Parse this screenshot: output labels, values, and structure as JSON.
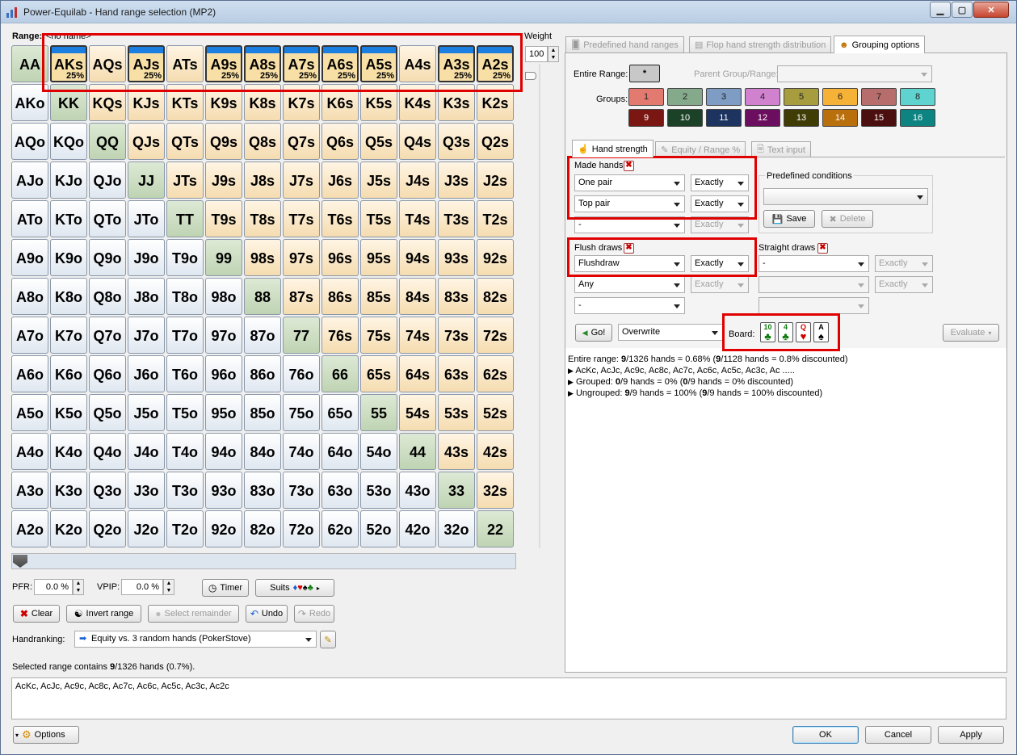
{
  "window": {
    "title": "Power-Equilab - Hand range selection (MP2)"
  },
  "range": {
    "label": "Range:",
    "name": "<no name>",
    "weight_label": "Weight",
    "weight_value": "100"
  },
  "grid": {
    "rows": [
      [
        "AA",
        "AKs",
        "AQs",
        "AJs",
        "ATs",
        "A9s",
        "A8s",
        "A7s",
        "A6s",
        "A5s",
        "A4s",
        "A3s",
        "A2s"
      ],
      [
        "AKo",
        "KK",
        "KQs",
        "KJs",
        "KTs",
        "K9s",
        "K8s",
        "K7s",
        "K6s",
        "K5s",
        "K4s",
        "K3s",
        "K2s"
      ],
      [
        "AQo",
        "KQo",
        "QQ",
        "QJs",
        "QTs",
        "Q9s",
        "Q8s",
        "Q7s",
        "Q6s",
        "Q5s",
        "Q4s",
        "Q3s",
        "Q2s"
      ],
      [
        "AJo",
        "KJo",
        "QJo",
        "JJ",
        "JTs",
        "J9s",
        "J8s",
        "J7s",
        "J6s",
        "J5s",
        "J4s",
        "J3s",
        "J2s"
      ],
      [
        "ATo",
        "KTo",
        "QTo",
        "JTo",
        "TT",
        "T9s",
        "T8s",
        "T7s",
        "T6s",
        "T5s",
        "T4s",
        "T3s",
        "T2s"
      ],
      [
        "A9o",
        "K9o",
        "Q9o",
        "J9o",
        "T9o",
        "99",
        "98s",
        "97s",
        "96s",
        "95s",
        "94s",
        "93s",
        "92s"
      ],
      [
        "A8o",
        "K8o",
        "Q8o",
        "J8o",
        "T8o",
        "98o",
        "88",
        "87s",
        "86s",
        "85s",
        "84s",
        "83s",
        "82s"
      ],
      [
        "A7o",
        "K7o",
        "Q7o",
        "J7o",
        "T7o",
        "97o",
        "87o",
        "77",
        "76s",
        "75s",
        "74s",
        "73s",
        "72s"
      ],
      [
        "A6o",
        "K6o",
        "Q6o",
        "J6o",
        "T6o",
        "96o",
        "86o",
        "76o",
        "66",
        "65s",
        "64s",
        "63s",
        "62s"
      ],
      [
        "A5o",
        "K5o",
        "Q5o",
        "J5o",
        "T5o",
        "95o",
        "85o",
        "75o",
        "65o",
        "55",
        "54s",
        "53s",
        "52s"
      ],
      [
        "A4o",
        "K4o",
        "Q4o",
        "J4o",
        "T4o",
        "94o",
        "84o",
        "74o",
        "64o",
        "54o",
        "44",
        "43s",
        "42s"
      ],
      [
        "A3o",
        "K3o",
        "Q3o",
        "J3o",
        "T3o",
        "93o",
        "83o",
        "73o",
        "63o",
        "53o",
        "43o",
        "33",
        "32s"
      ],
      [
        "A2o",
        "K2o",
        "Q2o",
        "J2o",
        "T2o",
        "92o",
        "82o",
        "72o",
        "62o",
        "52o",
        "42o",
        "32o",
        "22"
      ]
    ],
    "selected": {
      "AKs": "25%",
      "AJs": "25%",
      "A9s": "25%",
      "A8s": "25%",
      "A7s": "25%",
      "A6s": "25%",
      "A5s": "25%",
      "A3s": "25%",
      "A2s": "25%"
    }
  },
  "controls": {
    "pfr_label": "PFR:",
    "pfr_value": "0.0 %",
    "vpip_label": "VPIP:",
    "vpip_value": "0.0 %",
    "timer": "Timer",
    "suits": "Suits",
    "clear": "Clear",
    "invert": "Invert range",
    "select_remainder": "Select remainder",
    "undo": "Undo",
    "redo": "Redo",
    "handranking_label": "Handranking:",
    "handranking_value": "Equity vs. 3 random hands (PokerStove)"
  },
  "status": {
    "prefix": "Selected range contains ",
    "count": "9",
    "suffix": "/1326 hands (0.7%)."
  },
  "selected_text": "AcKc, AcJc, Ac9c, Ac8c, Ac7c, Ac6c, Ac5c, Ac3c, Ac2c",
  "tabs": {
    "predefined": "Predefined hand ranges",
    "flop": "Flop hand strength distribution",
    "grouping": "Grouping options"
  },
  "grouping": {
    "entire_range_label": "Entire Range:",
    "entire_range_btn": "*",
    "parent_label": "Parent Group/Range:",
    "groups_label": "Groups:",
    "groups": [
      {
        "n": "1",
        "c": "#e27a70"
      },
      {
        "n": "2",
        "c": "#84a98b"
      },
      {
        "n": "3",
        "c": "#7e9cc4"
      },
      {
        "n": "4",
        "c": "#d182cf"
      },
      {
        "n": "5",
        "c": "#a79c3e"
      },
      {
        "n": "6",
        "c": "#f5b237"
      },
      {
        "n": "7",
        "c": "#b66d6b"
      },
      {
        "n": "8",
        "c": "#5fd3d0"
      },
      {
        "n": "9",
        "c": "#7a1712"
      },
      {
        "n": "10",
        "c": "#1b4226"
      },
      {
        "n": "11",
        "c": "#1d3360"
      },
      {
        "n": "12",
        "c": "#6c0e5f"
      },
      {
        "n": "13",
        "c": "#3f3c06"
      },
      {
        "n": "14",
        "c": "#b96f0c"
      },
      {
        "n": "15",
        "c": "#4b0f10"
      },
      {
        "n": "16",
        "c": "#0e8482"
      }
    ]
  },
  "subtabs": {
    "strength": "Hand strength",
    "equity": "Equity / Range %",
    "text": "Text input"
  },
  "made_hands": {
    "label": "Made hands",
    "r1": "One pair",
    "r1b": "Exactly",
    "r2": "Top pair",
    "r2b": "Exactly",
    "r3": "-",
    "r3b": "Exactly"
  },
  "predefined_conditions": {
    "label": "Predefined conditions",
    "save": "Save",
    "delete": "Delete"
  },
  "flush_draws": {
    "label": "Flush draws",
    "r1": "Flushdraw",
    "r1b": "Exactly",
    "r2": "Any",
    "r2b": "Exactly",
    "r3": "-"
  },
  "straight_draws": {
    "label": "Straight draws",
    "r1": "-",
    "r1b": "Exactly",
    "r2b": "Exactly"
  },
  "go": {
    "label": "Go!",
    "mode": "Overwrite",
    "board_label": "Board:",
    "evaluate": "Evaluate"
  },
  "board": [
    {
      "rank": "10",
      "suit": "♣",
      "color": "#0a7a0a"
    },
    {
      "rank": "4",
      "suit": "♣",
      "color": "#0a7a0a"
    },
    {
      "rank": "Q",
      "suit": "♥",
      "color": "#d00000"
    },
    {
      "rank": "A",
      "suit": "♠",
      "color": "#000000"
    }
  ],
  "results": {
    "l1a": "Entire range: ",
    "l1b": "9",
    "l1c": "/1326 hands = 0.68%  (",
    "l1d": "9",
    "l1e": "/1128 hands = 0.8% discounted)",
    "l2": "AcKc, AcJc, Ac9c, Ac8c, Ac7c, Ac6c, Ac5c, Ac3c, Ac .....",
    "l3a": "Grouped: ",
    "l3b": "0",
    "l3c": "/9 hands = 0%  (",
    "l3d": "0",
    "l3e": "/9 hands = 0% discounted)",
    "l4a": "Ungrouped: ",
    "l4b": "9",
    "l4c": "/9 hands = 100%  (",
    "l4d": "9",
    "l4e": "/9 hands = 100% discounted)"
  },
  "footer": {
    "options": "Options",
    "ok": "OK",
    "cancel": "Cancel",
    "apply": "Apply"
  }
}
